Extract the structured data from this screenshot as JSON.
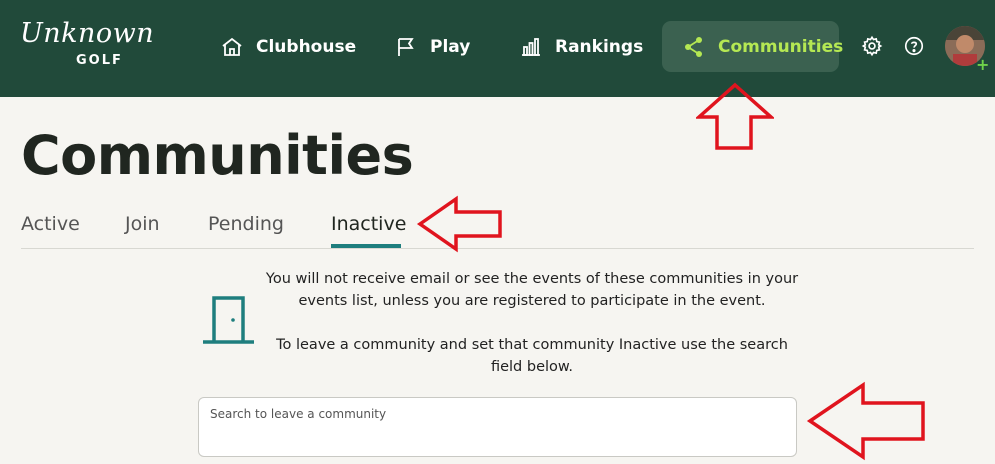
{
  "header": {
    "logo_script": "Unknown",
    "logo_sub": "GOLF",
    "nav": [
      {
        "label": "Clubhouse",
        "icon": "home-icon"
      },
      {
        "label": "Play",
        "icon": "flag-icon"
      },
      {
        "label": "Rankings",
        "icon": "bar-chart-icon"
      },
      {
        "label": "Communities",
        "icon": "share-icon"
      }
    ],
    "active_color": "#b5e853",
    "bar_color": "#214a3a"
  },
  "page": {
    "title": "Communities",
    "tabs": [
      "Active",
      "Join",
      "Pending",
      "Inactive"
    ],
    "active_tab": "Inactive"
  },
  "info": {
    "line1": "You will not receive email or see the events of these communities in your events list, unless you are registered to participate in the event.",
    "line2": "To leave a community and set that community Inactive use the search field below."
  },
  "search": {
    "placeholder": "Search to leave a community",
    "value": ""
  },
  "annotations": {
    "arrow_color": "#e0141e"
  }
}
